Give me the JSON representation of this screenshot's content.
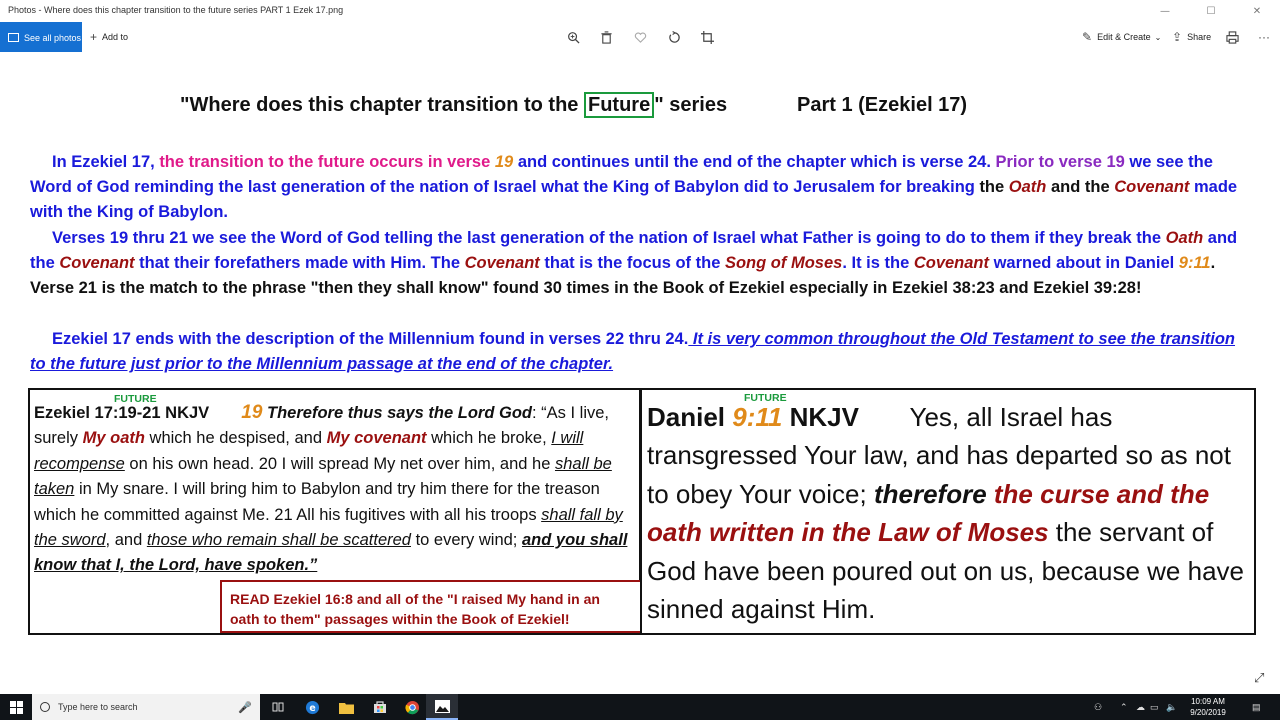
{
  "window": {
    "title": "Photos - Where does this chapter transition to the future series PART 1 Ezek 17.png",
    "controls": {
      "minimize": "—",
      "maximize": "☐",
      "close": "✕"
    }
  },
  "toolbar": {
    "see_all_photos": "See all photos",
    "add_to": "Add to",
    "edit_create": "Edit & Create",
    "share": "Share",
    "icons": [
      "zoom-icon",
      "delete-icon",
      "heart-icon",
      "rotate-icon",
      "crop-icon",
      "print-icon",
      "more-icon"
    ]
  },
  "doc": {
    "heading": {
      "pre": "\"Where does this chapter transition to the ",
      "boxed": "Future",
      "post": "\" series",
      "part": "Part 1   (Ezekiel 17)"
    },
    "p1": {
      "a": "In Ezekiel 17, ",
      "b": "the transition to the future occurs in verse ",
      "c": "19",
      "d": " and continues until the end of the chapter which is verse 24. ",
      "e": "Prior to verse 19",
      "f": " we see the Word of God reminding the last generation of the nation of Israel what the King of Babylon did to Jerusalem for breaking ",
      "g": "the ",
      "h": "Oath",
      "i": " and the ",
      "j": "Covenant",
      "k": " made with the King of Babylon."
    },
    "p2": {
      "a": "Verses 19 thru 21 we see the Word of God telling the last generation of the nation of Israel what Father is going to do to them if they break the ",
      "b": "Oath",
      "c": " and the ",
      "d": "Covenant",
      "e": " that their forefathers made with Him. The ",
      "f": "Covenant",
      "g": " that is the focus of the ",
      "h": "Song of Moses",
      "i": ". It is the ",
      "j": "Covenant",
      "k": " warned about in Daniel ",
      "l": "9:11",
      "m": ". Verse 21 is the match to the phrase \"then they shall know\" found 30 times in the Book of Ezekiel especially in Ezekiel 38:23 and Ezekiel 39:28!"
    },
    "p3": {
      "a": "Ezekiel 17 ends with the description of the Millennium found in verses 22 thru 24.",
      "b": " It is very common throughout the Old Testament to see the transition to the future just prior to the Millennium passage at the end of the chapter."
    },
    "left_box": {
      "future": "FUTURE",
      "ref": "Ezekiel 17:19-21 NKJV",
      "v19": "19",
      "t1": "Therefore thus says the Lord God",
      "t2": ": “As I live, surely ",
      "t3": "My oath",
      "t4": " which he despised, and ",
      "t5": "My covenant",
      "t6": " which he broke, ",
      "t7": "I will recompense",
      "t8": " on his own head. 20 I will spread My net over him, and he ",
      "t9": "shall be taken",
      "t10": " in My snare. I will bring him to Babylon and try him there for the treason which he committed against Me. 21 All his fugitives with all his troops ",
      "t11": "shall fall by the sword",
      "t12": ", and ",
      "t13": "those who remain shall be scattered",
      "t14": " to every wind; ",
      "t15": "and you shall know that I, the Lord, have spoken.”",
      "read": "READ Ezekiel 16:8 and all of the \"I raised My hand in an oath to them\" passages within the Book of Ezekiel!"
    },
    "right_box": {
      "future": "FUTURE",
      "ref_a": "Daniel ",
      "ref_b": "9:11",
      "ref_c": " NKJV",
      "t1": "Yes, all Israel has transgressed Your law, and has departed so as not to obey Your voice; ",
      "t2": "therefore",
      "t3": "the curse and the oath written in the Law of Moses",
      "t4": " the servant of God have been poured out on us, because we have sinned against Him."
    }
  },
  "taskbar": {
    "search_placeholder": "Type here to search",
    "time": "10:09 AM",
    "date": "9/20/2019",
    "apps": [
      "task-view-icon",
      "edge-icon",
      "file-explorer-icon",
      "store-icon",
      "chrome-icon",
      "photos-icon"
    ]
  }
}
